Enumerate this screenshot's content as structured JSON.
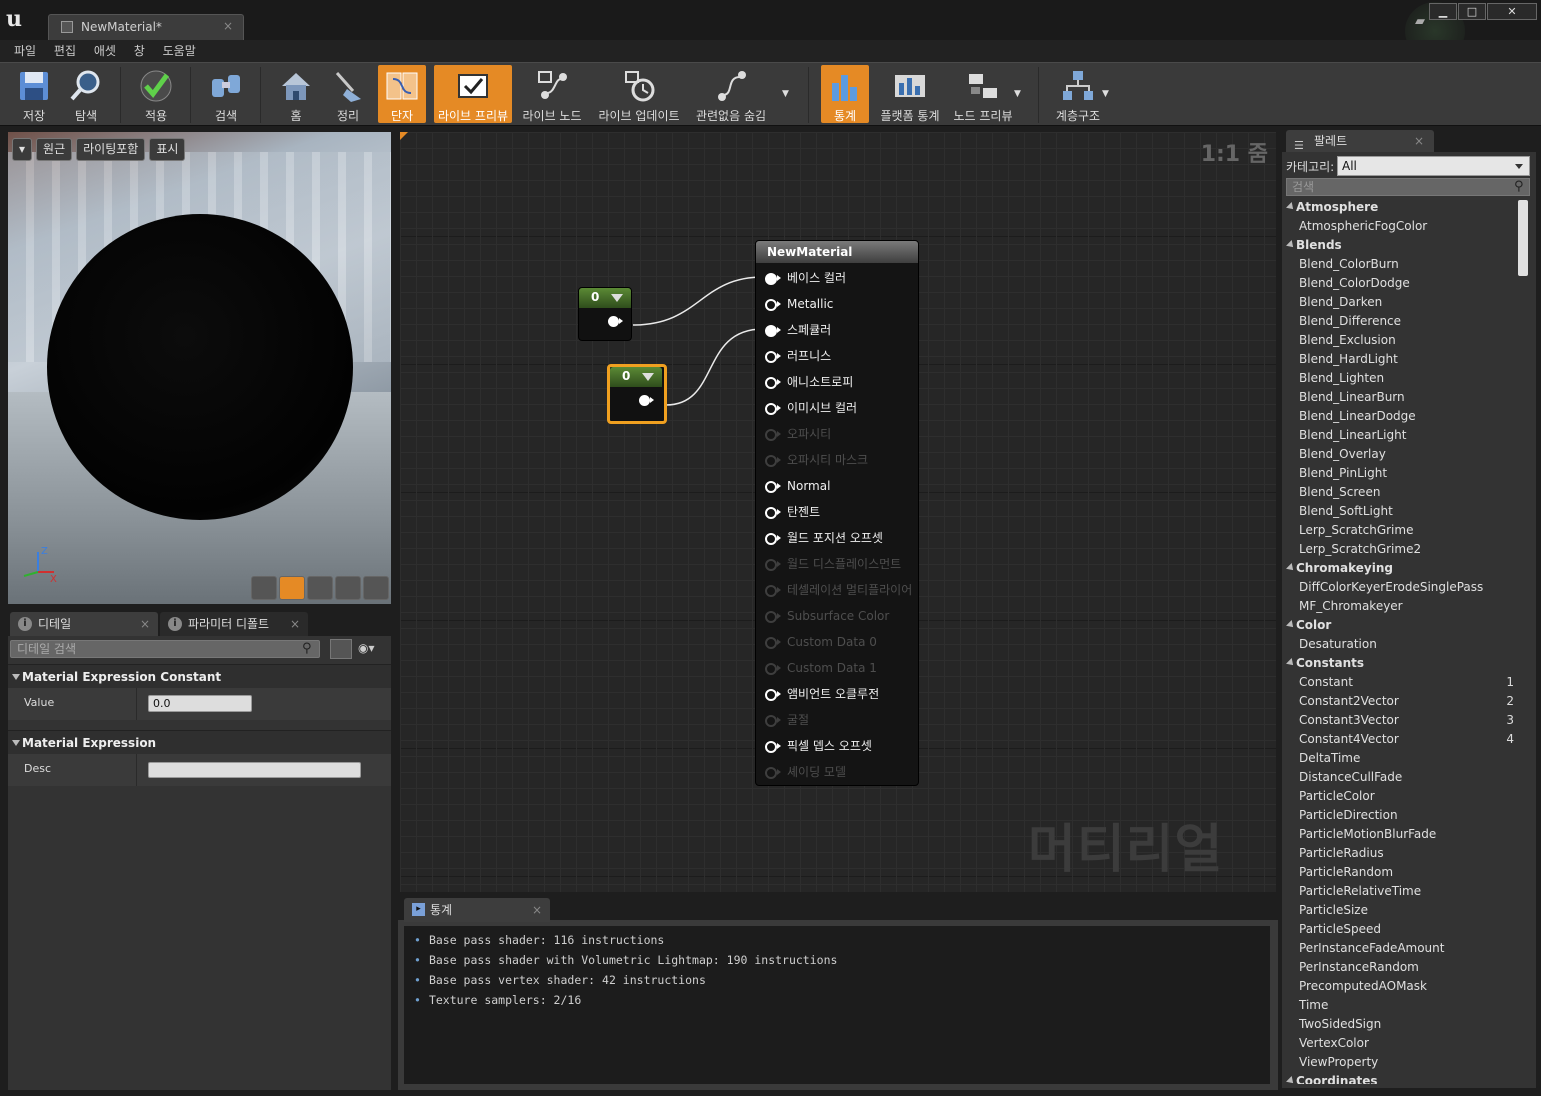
{
  "window": {
    "tab_title": "NewMaterial*",
    "tab_close": "×",
    "min": "▁",
    "max": "□",
    "close": "✕"
  },
  "menu": [
    "파일",
    "편집",
    "애셋",
    "창",
    "도움말"
  ],
  "toolbar": {
    "save": "저장",
    "browse": "탐색",
    "apply": "적용",
    "search": "검색",
    "home": "홈",
    "clean": "정리",
    "connectors": "단자",
    "live_preview": "라이브 프리뷰",
    "live_nodes": "라이브 노드",
    "live_update": "라이브 업데이트",
    "hide_unrelated": "관련없음 숨김",
    "stats": "통계",
    "platform_stats": "플랫폼 통계",
    "node_preview": "노드 프리뷰",
    "hierarchy": "계층구조"
  },
  "viewport": {
    "perspective_btn": "원근",
    "lit_btn": "라이팅포함",
    "show_btn": "표시",
    "axis_z": "Z",
    "axis_x": "X"
  },
  "details": {
    "tab_details": "디테일",
    "tab_params": "파라미터 디폴트",
    "tab_close": "×",
    "search_placeholder": "디테일 검색",
    "section1": "Material Expression Constant",
    "value_label": "Value",
    "value": "0.0",
    "section2": "Material Expression",
    "desc_label": "Desc",
    "desc_value": ""
  },
  "graph": {
    "zoom": "1:1 줌",
    "watermark": "머티리얼",
    "constant1_value": "0",
    "constant2_value": "0",
    "material_node_title": "NewMaterial",
    "pins": [
      {
        "label": "베이스 컬러",
        "state": "connected"
      },
      {
        "label": "Metallic",
        "state": "active"
      },
      {
        "label": "스페큘러",
        "state": "connected"
      },
      {
        "label": "러프니스",
        "state": "active"
      },
      {
        "label": "애니소트로피",
        "state": "active"
      },
      {
        "label": "이미시브 컬러",
        "state": "active"
      },
      {
        "label": "오파시티",
        "state": "disabled"
      },
      {
        "label": "오파시티 마스크",
        "state": "disabled"
      },
      {
        "label": "Normal",
        "state": "active"
      },
      {
        "label": "탄젠트",
        "state": "active"
      },
      {
        "label": "월드 포지션 오프셋",
        "state": "active"
      },
      {
        "label": "월드 디스플레이스먼트",
        "state": "disabled"
      },
      {
        "label": "테셀레이션 멀티플라이어",
        "state": "disabled"
      },
      {
        "label": "Subsurface Color",
        "state": "disabled"
      },
      {
        "label": "Custom Data 0",
        "state": "disabled"
      },
      {
        "label": "Custom Data 1",
        "state": "disabled"
      },
      {
        "label": "앰비언트 오클루전",
        "state": "active"
      },
      {
        "label": "굴절",
        "state": "disabled"
      },
      {
        "label": "픽셀 뎁스 오프셋",
        "state": "active"
      },
      {
        "label": "셰이딩 모델",
        "state": "disabled"
      }
    ]
  },
  "stats": {
    "tab": "통계",
    "tab_close": "×",
    "bullet": "•",
    "lines": [
      "Base pass shader: 116 instructions",
      "Base pass shader with Volumetric Lightmap: 190 instructions",
      "Base pass vertex shader: 42 instructions",
      "Texture samplers: 2/16"
    ]
  },
  "palette": {
    "tab": "팔레트",
    "tab_close": "×",
    "category_label": "카테고리:",
    "category_value": "All",
    "search_placeholder": "검색",
    "items": [
      {
        "t": "cat",
        "l": "Atmosphere"
      },
      {
        "t": "item",
        "l": "AtmosphericFogColor"
      },
      {
        "t": "cat",
        "l": "Blends"
      },
      {
        "t": "item",
        "l": "Blend_ColorBurn"
      },
      {
        "t": "item",
        "l": "Blend_ColorDodge"
      },
      {
        "t": "item",
        "l": "Blend_Darken"
      },
      {
        "t": "item",
        "l": "Blend_Difference"
      },
      {
        "t": "item",
        "l": "Blend_Exclusion"
      },
      {
        "t": "item",
        "l": "Blend_HardLight"
      },
      {
        "t": "item",
        "l": "Blend_Lighten"
      },
      {
        "t": "item",
        "l": "Blend_LinearBurn"
      },
      {
        "t": "item",
        "l": "Blend_LinearDodge"
      },
      {
        "t": "item",
        "l": "Blend_LinearLight"
      },
      {
        "t": "item",
        "l": "Blend_Overlay"
      },
      {
        "t": "item",
        "l": "Blend_PinLight"
      },
      {
        "t": "item",
        "l": "Blend_Screen"
      },
      {
        "t": "item",
        "l": "Blend_SoftLight"
      },
      {
        "t": "item",
        "l": "Lerp_ScratchGrime"
      },
      {
        "t": "item",
        "l": "Lerp_ScratchGrime2"
      },
      {
        "t": "cat",
        "l": "Chromakeying"
      },
      {
        "t": "item",
        "l": "DiffColorKeyerErodeSinglePass"
      },
      {
        "t": "item",
        "l": "MF_Chromakeyer"
      },
      {
        "t": "cat",
        "l": "Color"
      },
      {
        "t": "item",
        "l": "Desaturation"
      },
      {
        "t": "cat",
        "l": "Constants"
      },
      {
        "t": "item",
        "l": "Constant",
        "k": "1"
      },
      {
        "t": "item",
        "l": "Constant2Vector",
        "k": "2"
      },
      {
        "t": "item",
        "l": "Constant3Vector",
        "k": "3"
      },
      {
        "t": "item",
        "l": "Constant4Vector",
        "k": "4"
      },
      {
        "t": "item",
        "l": "DeltaTime"
      },
      {
        "t": "item",
        "l": "DistanceCullFade"
      },
      {
        "t": "item",
        "l": "ParticleColor"
      },
      {
        "t": "item",
        "l": "ParticleDirection"
      },
      {
        "t": "item",
        "l": "ParticleMotionBlurFade"
      },
      {
        "t": "item",
        "l": "ParticleRadius"
      },
      {
        "t": "item",
        "l": "ParticleRandom"
      },
      {
        "t": "item",
        "l": "ParticleRelativeTime"
      },
      {
        "t": "item",
        "l": "ParticleSize"
      },
      {
        "t": "item",
        "l": "ParticleSpeed"
      },
      {
        "t": "item",
        "l": "PerInstanceFadeAmount"
      },
      {
        "t": "item",
        "l": "PerInstanceRandom"
      },
      {
        "t": "item",
        "l": "PrecomputedAOMask"
      },
      {
        "t": "item",
        "l": "Time"
      },
      {
        "t": "item",
        "l": "TwoSidedSign"
      },
      {
        "t": "item",
        "l": "VertexColor"
      },
      {
        "t": "item",
        "l": "ViewProperty"
      },
      {
        "t": "cat",
        "l": "Coordinates"
      }
    ]
  },
  "colors": {
    "accent": "#e58a25",
    "constant_header": "#5b8a35",
    "panel": "#333333",
    "graph_bg": "#262626"
  }
}
